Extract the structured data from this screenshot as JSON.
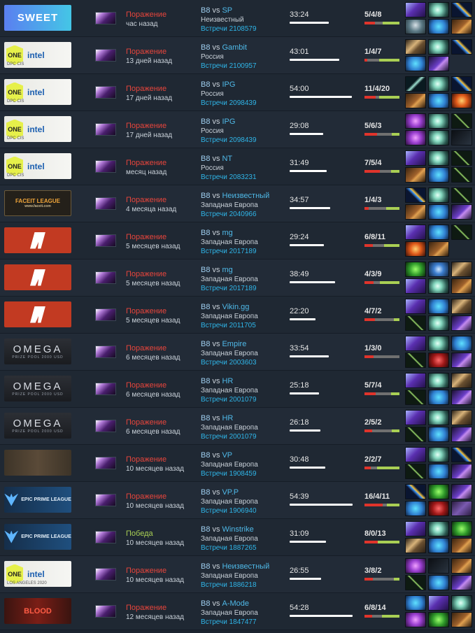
{
  "matches": [
    {
      "banner_type": "sweet",
      "banner_text": "SWEET",
      "result": "Поражение",
      "win": false,
      "ago": "час назад",
      "team": "B8",
      "vs": "vs",
      "opponent": "SP",
      "region": "Неизвестный",
      "match_label": "Встречи 2108579",
      "duration": "33:24",
      "duration_fraction": 0.61,
      "kda": "5/4/8",
      "k": 5,
      "d": 4,
      "a": 8,
      "items": [
        "it-blade",
        "it-wind",
        "it-staff",
        "it-mushroom",
        "it-crystal",
        "it-boot"
      ]
    },
    {
      "banner_type": "one",
      "banner_text": "ONE",
      "banner_sub": "DPC CIS",
      "result": "Поражение",
      "win": false,
      "ago": "13 дней назад",
      "team": "B8",
      "vs": "vs",
      "opponent": "Gambit",
      "region": "Россия",
      "match_label": "Встречи 2100957",
      "duration": "43:01",
      "duration_fraction": 0.78,
      "kda": "1/4/7",
      "k": 1,
      "d": 4,
      "a": 7,
      "items": [
        "it-hammer",
        "it-wind",
        "it-staff",
        "it-crystal",
        "it-shard"
      ]
    },
    {
      "banner_type": "one",
      "banner_text": "ONE",
      "banner_sub": "DPC CIS",
      "result": "Поражение",
      "win": false,
      "ago": "17 дней назад",
      "team": "B8",
      "vs": "vs",
      "opponent": "IPG",
      "region": "Россия",
      "match_label": "Встречи 2098439",
      "duration": "54:00",
      "duration_fraction": 0.98,
      "kda": "11/4/20",
      "k": 11,
      "d": 4,
      "a": 20,
      "items": [
        "it-dagger",
        "it-wind",
        "it-staff",
        "it-boot",
        "it-crystal",
        "it-fire"
      ]
    },
    {
      "banner_type": "one",
      "banner_text": "ONE",
      "banner_sub": "DPC CIS",
      "result": "Поражение",
      "win": false,
      "ago": "17 дней назад",
      "team": "B8",
      "vs": "vs",
      "opponent": "IPG",
      "region": "Россия",
      "match_label": "Встречи 2098439",
      "duration": "29:08",
      "duration_fraction": 0.53,
      "kda": "5/6/3",
      "k": 5,
      "d": 6,
      "a": 3,
      "items": [
        "it-orb",
        "it-wind",
        "it-wand",
        "it-orb",
        "it-wind",
        "it-dark"
      ]
    },
    {
      "banner_type": "one",
      "banner_text": "ONE",
      "banner_sub": "DPC CIS",
      "result": "Поражение",
      "win": false,
      "ago": "месяц назад",
      "team": "B8",
      "vs": "vs",
      "opponent": "NT",
      "region": "Россия",
      "match_label": "Встречи 2083231",
      "duration": "31:49",
      "duration_fraction": 0.58,
      "kda": "7/5/4",
      "k": 7,
      "d": 5,
      "a": 4,
      "items": [
        "it-blade",
        "it-wind",
        "it-wand",
        "it-boot",
        "it-crystal",
        "it-wand"
      ]
    },
    {
      "banner_type": "faceit",
      "banner_text": "FACEIT LEAGUE",
      "banner_sub": "www.faceit.com",
      "result": "Поражение",
      "win": false,
      "ago": "4 месяца назад",
      "team": "B8",
      "vs": "vs",
      "opponent": "Неизвестный",
      "region": "Западная Европа",
      "match_label": "Встречи 2040966",
      "duration": "34:57",
      "duration_fraction": 0.64,
      "kda": "1/4/3",
      "k": 1,
      "d": 4,
      "a": 3,
      "items": [
        "it-staff",
        "it-wind",
        "it-wand",
        "it-boot",
        "it-crystal",
        "it-shard"
      ]
    },
    {
      "banner_type": "red",
      "result": "Поражение",
      "win": false,
      "ago": "5 месяцев назад",
      "team": "B8",
      "vs": "vs",
      "opponent": "mg",
      "region": "Западная Европа",
      "match_label": "Встречи 2017189",
      "duration": "29:24",
      "duration_fraction": 0.54,
      "kda": "6/8/11",
      "k": 6,
      "d": 8,
      "a": 11,
      "items": [
        "it-blade",
        "it-crystal",
        "it-wand",
        "it-fire",
        "it-boot"
      ]
    },
    {
      "banner_type": "red",
      "result": "Поражение",
      "win": false,
      "ago": "5 месяцев назад",
      "team": "B8",
      "vs": "vs",
      "opponent": "mg",
      "region": "Западная Европа",
      "match_label": "Встречи 2017189",
      "duration": "38:49",
      "duration_fraction": 0.71,
      "kda": "4/3/9",
      "k": 4,
      "d": 3,
      "a": 9,
      "items": [
        "it-emerald",
        "it-disc",
        "it-hammer",
        "it-blade",
        "it-wind",
        "it-boot"
      ]
    },
    {
      "banner_type": "red",
      "result": "Поражение",
      "win": false,
      "ago": "5 месяцев назад",
      "team": "B8",
      "vs": "vs",
      "opponent": "Vikin.gg",
      "region": "Западная Европа",
      "match_label": "Встречи 2011705",
      "duration": "22:20",
      "duration_fraction": 0.41,
      "kda": "4/7/2",
      "k": 4,
      "d": 7,
      "a": 2,
      "items": [
        "it-blade",
        "it-crystal",
        "it-hammer",
        "it-wand",
        "it-wind",
        "it-shard"
      ]
    },
    {
      "banner_type": "omega",
      "banner_text": "OMEGA",
      "banner_sub": "PRIZE POOL 2000 USD",
      "result": "Поражение",
      "win": false,
      "ago": "6 месяцев назад",
      "team": "B8",
      "vs": "vs",
      "opponent": "Empire",
      "region": "Западная Европа",
      "match_label": "Встречи 2003603",
      "duration": "33:54",
      "duration_fraction": 0.62,
      "kda": "1/3/0",
      "k": 1,
      "d": 3,
      "a": 0,
      "items": [
        "it-blade",
        "it-wind",
        "it-crystal",
        "it-wand",
        "it-ruby",
        "it-shard"
      ]
    },
    {
      "banner_type": "omega",
      "banner_text": "OMEGA",
      "banner_sub": "PRIZE POOL 2000 USD",
      "result": "Поражение",
      "win": false,
      "ago": "6 месяцев назад",
      "team": "B8",
      "vs": "vs",
      "opponent": "HR",
      "region": "Западная Европа",
      "match_label": "Встречи 2001079",
      "duration": "25:18",
      "duration_fraction": 0.46,
      "kda": "5/7/4",
      "k": 5,
      "d": 7,
      "a": 4,
      "items": [
        "it-blade",
        "it-wind",
        "it-hammer",
        "it-wand",
        "it-crystal",
        "it-shard"
      ]
    },
    {
      "banner_type": "omega",
      "banner_text": "OMEGA",
      "banner_sub": "PRIZE POOL 2000 USD",
      "result": "Поражение",
      "win": false,
      "ago": "6 месяцев назад",
      "team": "B8",
      "vs": "vs",
      "opponent": "HR",
      "region": "Западная Европа",
      "match_label": "Встречи 2001079",
      "duration": "26:18",
      "duration_fraction": 0.48,
      "kda": "2/5/2",
      "k": 2,
      "d": 5,
      "a": 2,
      "items": [
        "it-blade",
        "it-wind",
        "it-hammer",
        "it-wand",
        "it-crystal",
        "it-shard"
      ]
    },
    {
      "banner_type": "vp",
      "result": "Поражение",
      "win": false,
      "ago": "10 месяцев назад",
      "team": "B8",
      "vs": "vs",
      "opponent": "VP",
      "region": "Западная Европа",
      "match_label": "Встречи 1908459",
      "duration": "30:48",
      "duration_fraction": 0.56,
      "kda": "2/2/7",
      "k": 2,
      "d": 2,
      "a": 7,
      "items": [
        "it-blade",
        "it-wind",
        "it-staff",
        "it-wand",
        "it-crystal",
        "it-shard"
      ]
    },
    {
      "banner_type": "epic",
      "banner_text": "EPIC PRIME LEAGUE",
      "result": "Поражение",
      "win": false,
      "ago": "10 месяцев назад",
      "team": "B8",
      "vs": "vs",
      "opponent": "VP.P",
      "region": "Западная Европа",
      "match_label": "Встречи 1906940",
      "duration": "54:39",
      "duration_fraction": 0.99,
      "kda": "16/4/11",
      "k": 16,
      "d": 4,
      "a": 11,
      "items": [
        "it-staff",
        "it-emerald",
        "it-shard",
        "it-crystal",
        "it-ruby",
        "it-armor"
      ]
    },
    {
      "banner_type": "epic",
      "banner_text": "EPIC PRIME LEAGUE",
      "result": "Победа",
      "win": true,
      "ago": "10 месяцев назад",
      "team": "B8",
      "vs": "vs",
      "opponent": "Winstrike",
      "region": "Западная Европа",
      "match_label": "Встречи 1887265",
      "duration": "31:09",
      "duration_fraction": 0.57,
      "kda": "8/0/13",
      "k": 8,
      "d": 0,
      "a": 13,
      "items": [
        "it-blade",
        "it-wind",
        "it-emerald",
        "it-hammer",
        "it-crystal",
        "it-boot"
      ]
    },
    {
      "banner_type": "one",
      "banner_text": "ONE",
      "banner_sub": "LOS ANGELES 2020",
      "result": "Поражение",
      "win": false,
      "ago": "10 месяцев назад",
      "team": "B8",
      "vs": "vs",
      "opponent": "Неизвестный",
      "region": "Западная Европа",
      "match_label": "Встречи 1886218",
      "duration": "26:55",
      "duration_fraction": 0.49,
      "kda": "3/8/2",
      "k": 3,
      "d": 8,
      "a": 2,
      "items": [
        "it-orb",
        "it-dark",
        "it-boot",
        "it-wand",
        "it-crystal",
        "it-shard"
      ]
    },
    {
      "banner_type": "blood",
      "banner_text": "BLOOD",
      "result": "Поражение",
      "win": false,
      "ago": "12 месяцев назад",
      "team": "B8",
      "vs": "vs",
      "opponent": "A-Mode",
      "region": "Западная Европа",
      "match_label": "Встречи 1847477",
      "duration": "54:28",
      "duration_fraction": 0.99,
      "kda": "6/8/14",
      "k": 6,
      "d": 8,
      "a": 14,
      "items": [
        "it-crystal",
        "it-blade",
        "it-wind",
        "it-orb",
        "it-emerald",
        "it-boot"
      ]
    }
  ]
}
